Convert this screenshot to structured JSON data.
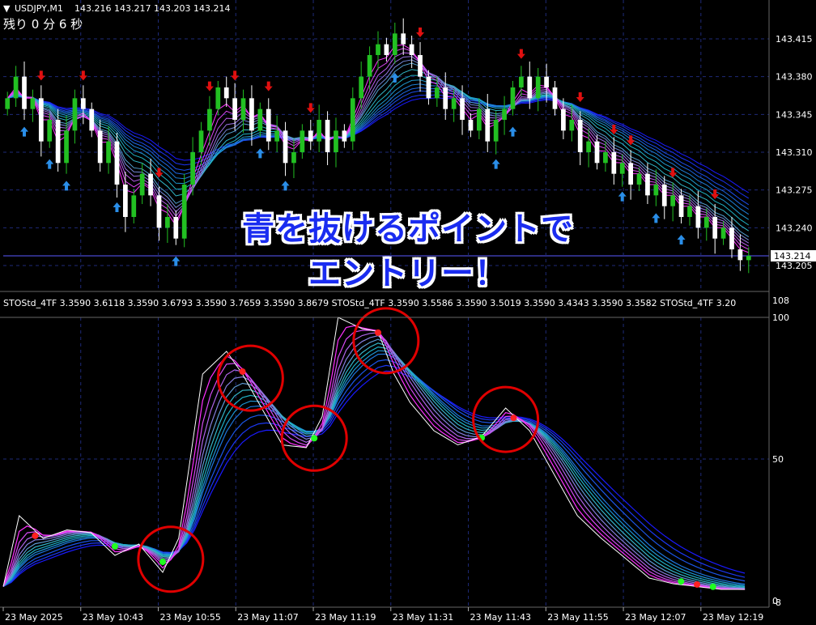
{
  "header": {
    "symbol_label": "USDJPY,M1",
    "ohlc_text": "143.216 143.217 143.203 143.214",
    "countdown": "残り 0 分 6 秒"
  },
  "indicator_header": "STOStd_4TF 3.3590 3.6118 3.3590 3.6793 3.3590 3.7659 3.3590 3.8679   STOStd_4TF 3.3590 3.5586 3.3590 3.5019 3.3590 3.4343 3.3590 3.3582   STOStd_4TF 3.20",
  "overlay": {
    "line1": "青を抜けるポイントで",
    "line2": "エントリー！"
  },
  "colors": {
    "background": "#000000",
    "grid": "#1e2a78",
    "bull": "#22c022",
    "bear": "#ffffff",
    "arrow_up": "#2a8ee8",
    "arrow_down": "#e01010",
    "ribbon_slow": "#1a1aff",
    "ribbon_mid": "#20c0c0",
    "ribbon_fast": "#ff30ff",
    "circle": "#e00000",
    "dot_red": "#ff2020",
    "dot_green": "#20ff20"
  },
  "chart_data": [
    {
      "type": "candlestick",
      "title": "USDJPY,M1",
      "ylim": [
        143.19,
        143.43
      ],
      "y_ticks": [
        "143.415",
        "143.380",
        "143.345",
        "143.310",
        "143.275",
        "143.240",
        "143.205"
      ],
      "current_price": "143.214",
      "x_ticks": [
        "23 May 2025",
        "23 May 10:43",
        "23 May 10:55",
        "23 May 11:07",
        "23 May 11:19",
        "23 May 11:31",
        "23 May 11:43",
        "23 May 11:55",
        "23 May 12:07",
        "23 May 12:19"
      ],
      "close_path": [
        143.36,
        143.38,
        143.35,
        143.36,
        143.32,
        143.34,
        143.3,
        143.33,
        143.36,
        143.35,
        143.33,
        143.3,
        143.32,
        143.28,
        143.25,
        143.27,
        143.29,
        143.27,
        143.24,
        143.25,
        143.23,
        143.28,
        143.31,
        143.33,
        143.35,
        143.37,
        143.36,
        143.34,
        143.36,
        143.33,
        143.35,
        143.32,
        143.33,
        143.3,
        143.31,
        143.33,
        143.32,
        143.34,
        143.31,
        143.33,
        143.32,
        143.36,
        143.38,
        143.4,
        143.41,
        143.4,
        143.42,
        143.41,
        143.4,
        143.38,
        143.36,
        143.37,
        143.35,
        143.36,
        143.34,
        143.33,
        143.35,
        143.32,
        143.34,
        143.35,
        143.37,
        143.38,
        143.36,
        143.38,
        143.37,
        143.35,
        143.33,
        143.34,
        143.31,
        143.32,
        143.3,
        143.31,
        143.29,
        143.3,
        143.28,
        143.29,
        143.27,
        143.28,
        143.26,
        143.27,
        143.25,
        143.26,
        143.24,
        143.25,
        143.23,
        143.24,
        143.22,
        143.21,
        143.214
      ],
      "arrows_up_idx": [
        2,
        5,
        7,
        13,
        20,
        30,
        33,
        46,
        58,
        60,
        73,
        77,
        80
      ],
      "arrows_down_idx": [
        4,
        9,
        18,
        24,
        27,
        31,
        36,
        49,
        61,
        68,
        72,
        74,
        79,
        84
      ]
    },
    {
      "type": "line",
      "title": "STOStd_4TF",
      "ylim": [
        0,
        100
      ],
      "y_ticks": [
        "100",
        "50",
        "0"
      ],
      "y_ticks_right": [
        "108",
        "-8"
      ],
      "x": [
        0,
        2,
        5,
        8,
        11,
        14,
        17,
        20,
        22,
        25,
        28,
        30,
        32,
        35,
        38,
        40,
        42,
        45,
        47,
        49,
        51,
        54,
        57,
        60,
        63,
        66,
        69,
        72,
        75,
        78,
        81,
        84,
        87,
        90,
        93
      ],
      "series": [
        {
          "values": [
            5,
            30,
            22,
            25,
            24,
            16,
            20,
            10,
            22,
            80,
            88,
            80,
            70,
            55,
            54,
            65,
            100,
            96,
            95,
            80,
            70,
            60,
            55,
            58,
            68,
            60,
            45,
            30,
            22,
            15,
            8,
            6,
            5,
            4,
            4
          ]
        }
      ],
      "circles_x": [
        21,
        31,
        39,
        48,
        63
      ],
      "dots_red_x": [
        4,
        30,
        47,
        64,
        87
      ],
      "dots_green_x": [
        14,
        20,
        39,
        60,
        85,
        89
      ]
    }
  ]
}
